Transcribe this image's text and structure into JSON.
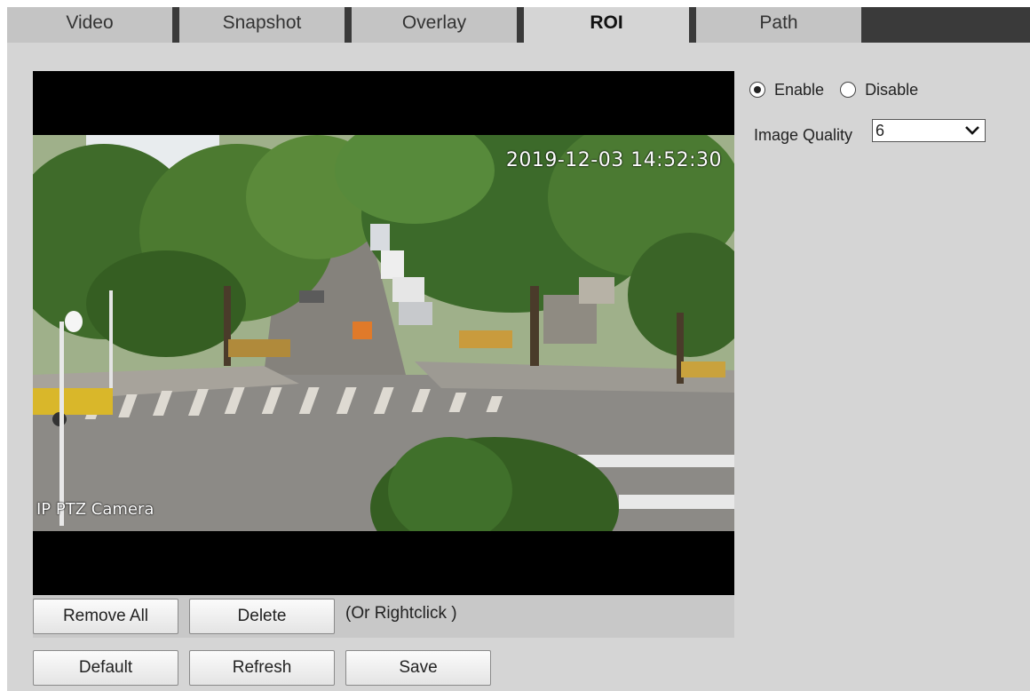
{
  "tabs": [
    {
      "label": "Video",
      "active": false
    },
    {
      "label": "Snapshot",
      "active": false
    },
    {
      "label": "Overlay",
      "active": false
    },
    {
      "label": "ROI",
      "active": true
    },
    {
      "label": "Path",
      "active": false
    }
  ],
  "video": {
    "timestamp": "2019-12-03 14:52:30",
    "channel_name": "IP PTZ Camera"
  },
  "roi_toolbar": {
    "remove_all_label": "Remove All",
    "delete_label": "Delete",
    "hint": "(Or Rightclick )"
  },
  "settings": {
    "enable_label": "Enable",
    "disable_label": "Disable",
    "enabled": true,
    "image_quality_label": "Image Quality",
    "image_quality_value": "6"
  },
  "footer": {
    "default_label": "Default",
    "refresh_label": "Refresh",
    "save_label": "Save"
  },
  "colors": {
    "page_bg": "#d5d5d5",
    "tab_bg": "#c4c4c4",
    "tab_separator": "#3a3a3a",
    "toolbar_bg": "#c8c8c8"
  }
}
